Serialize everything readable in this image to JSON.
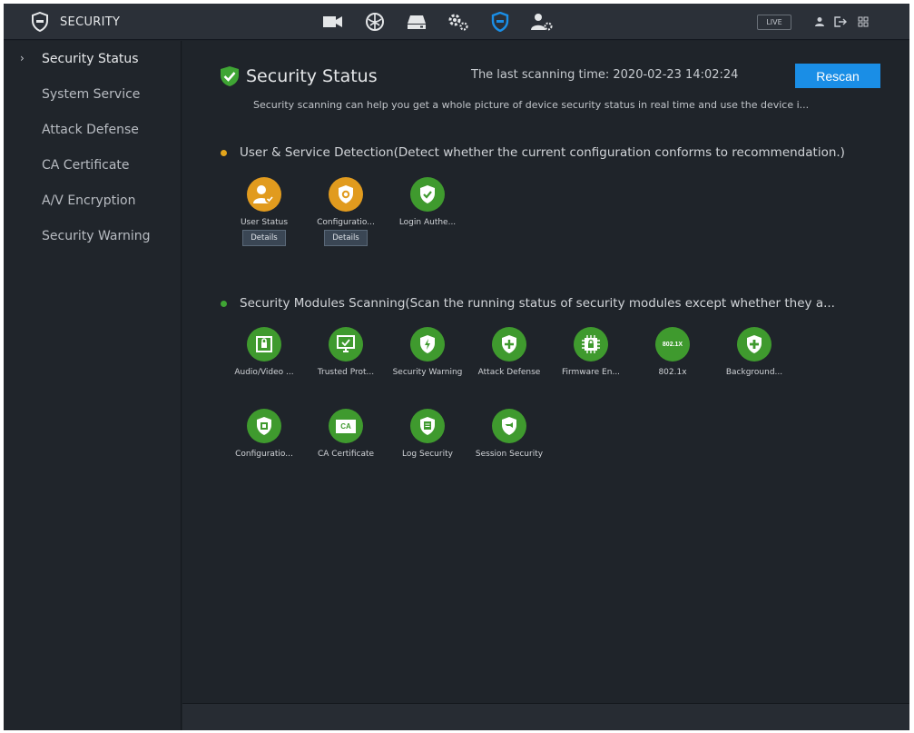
{
  "header": {
    "title": "SECURITY",
    "nav_icons": [
      "camera-icon",
      "network-icon",
      "storage-icon",
      "system-gear-icon",
      "security-shield-icon",
      "account-icon"
    ],
    "live_label": "LIVE"
  },
  "sidebar": {
    "items": [
      {
        "label": "Security Status",
        "active": true
      },
      {
        "label": "System Service"
      },
      {
        "label": "Attack Defense"
      },
      {
        "label": "CA Certificate"
      },
      {
        "label": "A/V Encryption"
      },
      {
        "label": "Security Warning"
      }
    ]
  },
  "main": {
    "title": "Security Status",
    "last_scan": "The last scanning time: 2020-02-23 14:02:24",
    "rescan_label": "Rescan",
    "description": "Security scanning can help you get a whole picture of device security status in real time and use the device i...",
    "detection": {
      "title": "User & Service Detection(Detect whether the current configuration conforms to recommendation.)",
      "items": [
        {
          "label": "User Status",
          "status": "warning",
          "icon": "user-status-icon",
          "details": "Details"
        },
        {
          "label": "Configuratio...",
          "status": "warning",
          "icon": "configuration-icon",
          "details": "Details"
        },
        {
          "label": "Login Authe...",
          "status": "ok",
          "icon": "login-authentication-icon"
        }
      ]
    },
    "modules": {
      "title": "Security Modules Scanning(Scan the running status of security modules except whether they a...",
      "items": [
        {
          "label": "Audio/Video ...",
          "icon": "audio-video-icon"
        },
        {
          "label": "Trusted Prot...",
          "icon": "trusted-protection-icon"
        },
        {
          "label": "Security Warning",
          "icon": "security-warning-icon"
        },
        {
          "label": "Attack Defense",
          "icon": "attack-defense-icon"
        },
        {
          "label": "Firmware En...",
          "icon": "firmware-encryption-icon"
        },
        {
          "label": "802.1x",
          "icon": "802-1x-icon",
          "badge": "802.1X"
        },
        {
          "label": "Background...",
          "icon": "background-icon"
        },
        {
          "label": "Configuratio...",
          "icon": "configuration-security-icon"
        },
        {
          "label": "CA Certificate",
          "icon": "ca-certificate-icon",
          "badge": "CA"
        },
        {
          "label": "Log Security",
          "icon": "log-security-icon"
        },
        {
          "label": "Session Security",
          "icon": "session-security-icon"
        }
      ]
    }
  },
  "colors": {
    "warning": "#e19b1e",
    "ok": "#3f9a2e",
    "accent": "#1a8ee6",
    "active_nav": "#1a8ee6"
  }
}
